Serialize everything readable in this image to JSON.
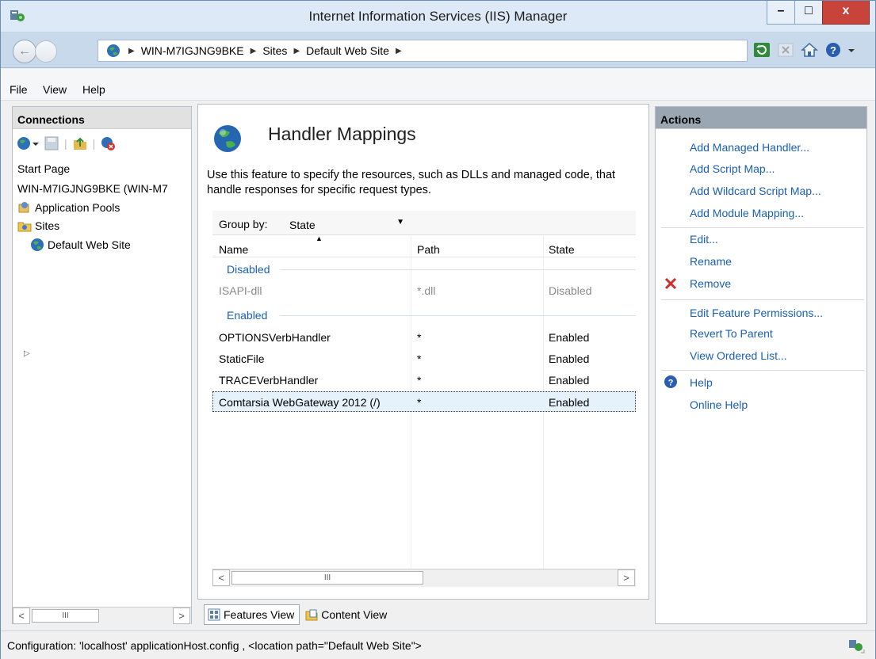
{
  "window": {
    "title": "Internet Information Services (IIS) Manager",
    "minimize_glyph": "–",
    "maximize_glyph": "□",
    "close_glyph": "x"
  },
  "address": {
    "back_glyph": "←",
    "crumbs": [
      "WIN-M7IGJNG9BKE",
      "Sites",
      "Default Web Site"
    ],
    "separator": "▶",
    "toolbar_icons": [
      "refresh-icon",
      "stop-icon",
      "home-icon",
      "help-icon"
    ]
  },
  "menu": [
    "File",
    "View",
    "Help"
  ],
  "connections": {
    "header": "Connections",
    "toolbar_icons": [
      "connect-icon",
      "save-icon",
      "up-icon",
      "delete-connection-icon"
    ],
    "tree": {
      "start_page": "Start Page",
      "server": "WIN-M7IGJNG9BKE (WIN-M7",
      "app_pools": "Application Pools",
      "sites": "Sites",
      "default_site": "Default Web Site"
    },
    "scroll_left": "<",
    "scroll_thumb": "III",
    "scroll_right": ">"
  },
  "feature": {
    "title": "Handler Mappings",
    "description": "Use this feature to specify the resources, such as DLLs and managed code, that handle responses for specific request types.",
    "group_by_label": "Group by:",
    "group_by_value": "State",
    "columns": [
      "Name",
      "Path",
      "State"
    ],
    "groups": [
      {
        "label": "Disabled",
        "rows": [
          {
            "name": "ISAPI-dll",
            "path": "*.dll",
            "state": "Disabled"
          }
        ]
      },
      {
        "label": "Enabled",
        "rows": [
          {
            "name": "OPTIONSVerbHandler",
            "path": "*",
            "state": "Enabled"
          },
          {
            "name": "StaticFile",
            "path": "*",
            "state": "Enabled"
          },
          {
            "name": "TRACEVerbHandler",
            "path": "*",
            "state": "Enabled"
          },
          {
            "name": "Comtarsia WebGateway 2012 (/)",
            "path": "*",
            "state": "Enabled"
          }
        ]
      }
    ],
    "scroll_left": "<",
    "scroll_thumb": "III",
    "scroll_right": ">"
  },
  "view_tabs": [
    "Features View",
    "Content View"
  ],
  "actions": {
    "header": "Actions",
    "add_managed": "Add Managed Handler...",
    "add_script_map": "Add Script Map...",
    "add_wildcard": "Add Wildcard Script Map...",
    "add_module": "Add Module Mapping...",
    "edit": "Edit...",
    "rename": "Rename",
    "remove": "Remove",
    "edit_permissions": "Edit Feature Permissions...",
    "revert": "Revert To Parent",
    "view_ordered": "View Ordered List...",
    "help": "Help",
    "online_help": "Online Help"
  },
  "status": {
    "text": "Configuration: 'localhost' applicationHost.config , <location path=\"Default Web Site\">"
  },
  "colors": {
    "link": "#1a5fb4",
    "selected_row": "#e5f1fb",
    "actions_header": "#9aa7b3",
    "close_button": "#c8433a"
  }
}
